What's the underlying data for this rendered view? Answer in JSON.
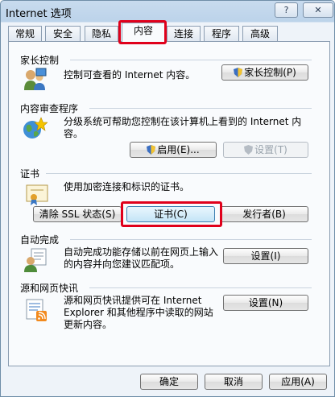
{
  "window": {
    "title": "Internet 选项",
    "help": "?",
    "close": "✕"
  },
  "tabs": [
    {
      "label": "常规"
    },
    {
      "label": "安全"
    },
    {
      "label": "隐私"
    },
    {
      "label": "内容",
      "active": true
    },
    {
      "label": "连接"
    },
    {
      "label": "程序"
    },
    {
      "label": "高级"
    }
  ],
  "parental": {
    "title": "家长控制",
    "description": "控制可查看的 Internet 内容。",
    "button": "家长控制(P)"
  },
  "advisor": {
    "title": "内容审查程序",
    "description": "分级系统可帮助您控制在该计算机上看到的 Internet 内容。",
    "enable_button": "启用(E)...",
    "settings_button": "设置(T)"
  },
  "certificates": {
    "title": "证书",
    "description": "使用加密连接和标识的证书。",
    "clear_ssl_button": "清除 SSL 状态(S)",
    "certificates_button": "证书(C)",
    "publishers_button": "发行者(B)"
  },
  "autocomplete": {
    "title": "自动完成",
    "description": "自动完成功能存储以前在网页上输入的内容并向您建议匹配项。",
    "settings_button": "设置(I)"
  },
  "feeds": {
    "title": "源和网页快讯",
    "description": "源和网页快讯提供可在 Internet Explorer 和其他程序中读取的网站更新内容。",
    "settings_button": "设置(N)"
  },
  "footer": {
    "ok": "确定",
    "cancel": "取消",
    "apply": "应用(A)"
  }
}
